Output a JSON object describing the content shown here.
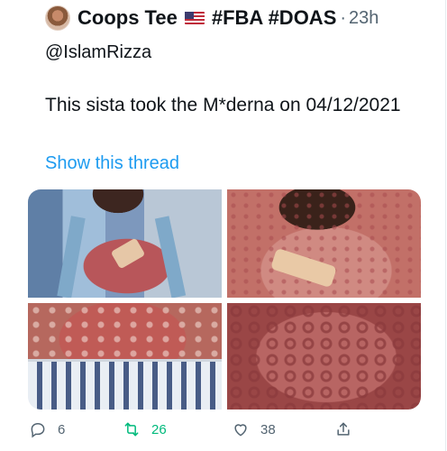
{
  "tweet": {
    "display_name": "Coops Tee",
    "flag_icon": "us-flag-icon",
    "hashtags": "#FBA #DOAS",
    "separator": "·",
    "time": "23h",
    "mention": "@IslamRizza",
    "text": "This sista took the M*derna on 04/12/2021",
    "show_thread": "Show this thread",
    "accent_color": "#1d9bf0",
    "retweet_color": "#00ba7c"
  },
  "actions": {
    "reply_count": "6",
    "retweet_count": "26",
    "like_count": "38"
  }
}
